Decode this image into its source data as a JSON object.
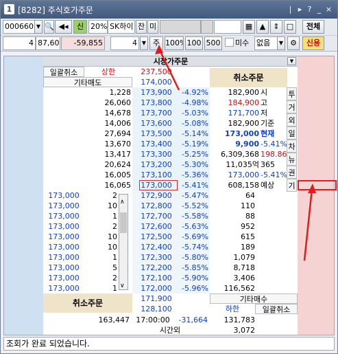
{
  "window": {
    "number": "1",
    "title": "[8282] 주식호가주문"
  },
  "toolbar": {
    "code": "000660",
    "shin": "신",
    "margin": "20%",
    "stock_name": "SK하이",
    "jan": "잔",
    "mi": "미",
    "view_all": "전체"
  },
  "order": {
    "qty_left": "4",
    "price": "87,600",
    "diff": "-59,855",
    "shares": "4",
    "ju": "주",
    "b100p": "100%",
    "b100": "100",
    "b500": "500",
    "misu": "미수",
    "opt": "없음",
    "credit": "신용"
  },
  "grid": {
    "title": "시장가주문",
    "top_cancel_all": "일괄취소",
    "upper_limit_label": "상한",
    "upper_limit": "237,500",
    "other_sell": "기타매도",
    "top_price": "174,000",
    "cancel_order": "취소주문",
    "cancel_order2": "취소주문",
    "other_buy": "기타매수",
    "lower_limit_label": "하한",
    "lower_limit": "128,100",
    "bottom_cancel_all": "일괄취소",
    "top_price2": "171,900",
    "ask": [
      {
        "qty": "1,228",
        "price": "173,900",
        "rate": "-4.92%"
      },
      {
        "qty": "26,060",
        "price": "173,800",
        "rate": "-4.98%"
      },
      {
        "qty": "14,678",
        "price": "173,700",
        "rate": "-5.03%"
      },
      {
        "qty": "14,006",
        "price": "173,600",
        "rate": "-5.08%"
      },
      {
        "qty": "27,694",
        "price": "173,500",
        "rate": "-5.14%"
      },
      {
        "qty": "13,670",
        "price": "173,400",
        "rate": "-5.19%"
      },
      {
        "qty": "13,417",
        "price": "173,300",
        "rate": "-5.25%"
      },
      {
        "qty": "20,624",
        "price": "173,200",
        "rate": "-5.30%"
      },
      {
        "qty": "16,005",
        "price": "173,100",
        "rate": "-5.36%"
      },
      {
        "qty": "16,065",
        "price": "173,000",
        "rate": "-5.41%"
      }
    ],
    "info": [
      {
        "v": "182,900",
        "k": "시"
      },
      {
        "v": "184,900",
        "k": "고"
      },
      {
        "v": "171,700",
        "k": "저"
      },
      {
        "v": "182,900",
        "k": "기준"
      },
      {
        "v": "173,000",
        "k": "현재"
      },
      {
        "v": "9,900",
        "k": "-5.41%"
      },
      {
        "v": "6,309,368",
        "k": "198.86"
      },
      {
        "v": "11,035억",
        "k": "365"
      },
      {
        "v": "173,000",
        "k": "-5.41%"
      },
      {
        "v": "608,158",
        "k": "예상"
      }
    ],
    "side": [
      "투",
      "거",
      "외",
      "일",
      "차",
      "뉴",
      "권",
      "기"
    ],
    "bid": [
      {
        "ord": "173,000",
        "cnt": "2",
        "price": "172,900",
        "rate": "-5.47%",
        "qty": "64"
      },
      {
        "ord": "173,000",
        "cnt": "10",
        "price": "172,800",
        "rate": "-5.52%",
        "qty": "110"
      },
      {
        "ord": "173,000",
        "cnt": "1",
        "price": "172,700",
        "rate": "-5.58%",
        "qty": "88"
      },
      {
        "ord": "173,000",
        "cnt": "2",
        "price": "172,600",
        "rate": "-5.63%",
        "qty": "952"
      },
      {
        "ord": "173,000",
        "cnt": "10",
        "price": "172,500",
        "rate": "-5.69%",
        "qty": "615"
      },
      {
        "ord": "173,000",
        "cnt": "10",
        "price": "172,400",
        "rate": "-5.74%",
        "qty": "189"
      },
      {
        "ord": "173,000",
        "cnt": "1",
        "price": "172,300",
        "rate": "-5.80%",
        "qty": "1,079"
      },
      {
        "ord": "173,000",
        "cnt": "5",
        "price": "172,200",
        "rate": "-5.85%",
        "qty": "8,718"
      },
      {
        "ord": "173,000",
        "cnt": "2",
        "price": "172,100",
        "rate": "-5.90%",
        "qty": "3,406"
      },
      {
        "ord": "173,000",
        "cnt": "1",
        "price": "172,000",
        "rate": "-5.96%",
        "qty": "116,562"
      }
    ],
    "total_sell": "163,447",
    "time": "17:00:00",
    "diff_total": "-31,664",
    "total_buy": "131,783",
    "after_hours_label": "시간외",
    "after_hours": "3,072"
  },
  "status": "조회가 완료 되었습니다."
}
